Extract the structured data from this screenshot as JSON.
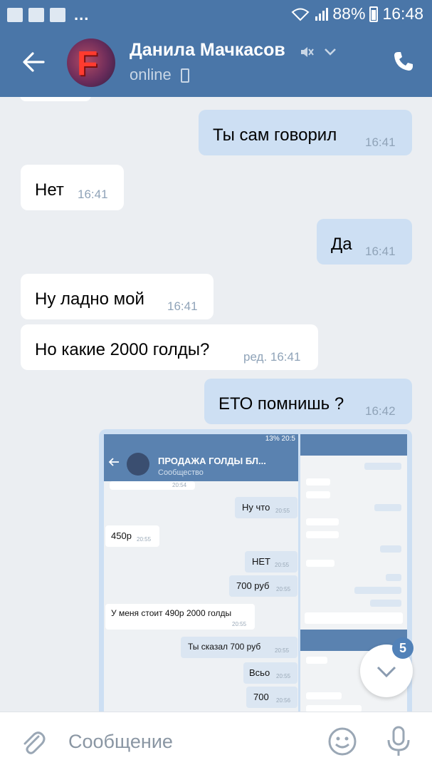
{
  "statusbar": {
    "battery": "88%",
    "time": "16:48"
  },
  "header": {
    "title": "Данила Мачкасов",
    "status": "online",
    "avatar_letter": "F"
  },
  "messages": [
    {
      "text": "Ты сам говорил",
      "time": "16:41"
    },
    {
      "text": "Нет",
      "time": "16:41"
    },
    {
      "text": "Да",
      "time": "16:41"
    },
    {
      "text": "Ну ладно мой",
      "time": "16:41"
    },
    {
      "text": "Но какие 2000 голды?",
      "time": "ред. 16:41"
    },
    {
      "text": "ЕТО помнишь ?",
      "time": "16:42"
    }
  ],
  "attachment": {
    "status_right": "13% 20:5",
    "chat_title": "ПРОДАЖА ГОЛДЫ БЛ...",
    "chat_subtitle": "Сообщество",
    "messages": [
      {
        "text": "Ну что",
        "time": "20:55"
      },
      {
        "text": "450р",
        "time": "20:55"
      },
      {
        "text": "НЕТ",
        "time": "20:55"
      },
      {
        "text": "700 руб",
        "time": "20:55"
      },
      {
        "text": "У меня стоит 490р 2000 голды",
        "time": "20:55"
      },
      {
        "text": "Ты сказал 700 руб",
        "time": "20:55"
      },
      {
        "text": "Всьо",
        "time": "20:55"
      },
      {
        "text": "700",
        "time": "20:56"
      }
    ],
    "top_cut_time": "20:54"
  },
  "scroll_badge": "5",
  "composer": {
    "placeholder": "Сообщение"
  },
  "colors": {
    "header": "#4a76a8",
    "outgoing": "#cddff3",
    "incoming": "#ffffff",
    "background": "#ebeef2",
    "badge": "#5181b8"
  }
}
